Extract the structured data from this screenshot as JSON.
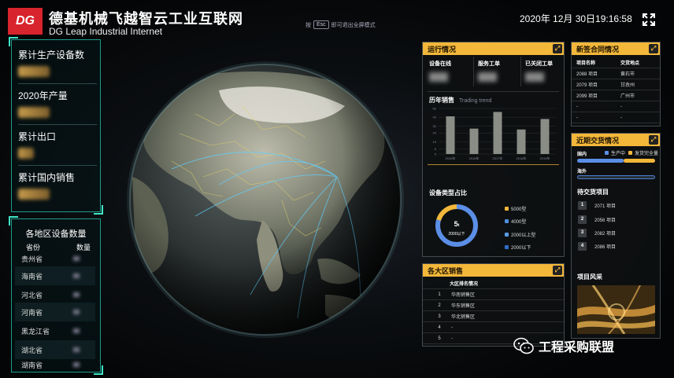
{
  "header": {
    "logo": "DG",
    "title": "德基机械飞越智云工业互联网",
    "subtitle": "DG Leap Industrial Internet",
    "esc_prefix": "按",
    "esc_key": "Esc",
    "esc_suffix": "即可退出全屏模式",
    "datetime": "2020年 12月 30日19:16:58"
  },
  "left_stats": [
    {
      "label": "累计生产设备数"
    },
    {
      "label": "2020年产量"
    },
    {
      "label": "累计出口"
    },
    {
      "label": "累计国内销售"
    }
  ],
  "region": {
    "title": "各地区设备数量",
    "col_province": "省份",
    "col_count": "数量",
    "rows": [
      {
        "province": "贵州省"
      },
      {
        "province": "海南省"
      },
      {
        "province": "河北省"
      },
      {
        "province": "河南省"
      },
      {
        "province": "黑龙江省"
      },
      {
        "province": "湖北省"
      },
      {
        "province": "湖南省"
      }
    ]
  },
  "operation": {
    "title": "运行情况",
    "online": "设备在线",
    "service": "服务工单",
    "closed": "已关闭工单",
    "sales_title": "历年销售",
    "sales_sub": "Trading trend",
    "type_title": "设备类型占比",
    "donut_value": "5",
    "donut_unit": "t",
    "donut_label": "2000以下",
    "legend": [
      {
        "label": "5000型",
        "color": "#f3b73a"
      },
      {
        "label": "4000型",
        "color": "#4e8fe0"
      },
      {
        "label": "2000以上型",
        "color": "#5b9be6"
      },
      {
        "label": "2000以下",
        "color": "#2e6fc8"
      }
    ]
  },
  "chart_data": {
    "type": "bar",
    "categories": [
      "2015年",
      "2016年",
      "2017年",
      "2018年",
      "2019年"
    ],
    "values": [
      43,
      29,
      48,
      28,
      40
    ],
    "ylim": [
      0,
      52
    ],
    "yticks": [
      0,
      6,
      14,
      24,
      32,
      42,
      52
    ],
    "bar_color": "#8a8d86"
  },
  "contracts": {
    "title": "新签合同情况",
    "col_name": "项目名称",
    "col_place": "交货地点",
    "rows": [
      {
        "name": "2088 项目",
        "place": "黄石市"
      },
      {
        "name": "2079 项目",
        "place": "甘孜州"
      },
      {
        "name": "2099 项目",
        "place": "广州市"
      },
      {
        "name": "-",
        "place": "-"
      },
      {
        "name": "-",
        "place": "-"
      }
    ]
  },
  "delivery": {
    "title": "近期交货情况",
    "domestic": "国内",
    "overseas": "海外",
    "leg_prod": "生产中",
    "leg_shipped": "发货完全量",
    "leg_prod_color": "#5b8ee6",
    "leg_shipped_color": "#f3b73a",
    "pending_title": "待交货项目",
    "pending": [
      {
        "no": "1",
        "name": "2071 项目"
      },
      {
        "no": "2",
        "name": "2056 项目"
      },
      {
        "no": "3",
        "name": "2082 项目"
      },
      {
        "no": "4",
        "name": "2086 项目"
      }
    ],
    "photo_title": "项目风采"
  },
  "regions_sales": {
    "title": "各大区销售",
    "col": "大区排名情况",
    "rows": [
      {
        "no": "1",
        "name": "华南销售区"
      },
      {
        "no": "2",
        "name": "华东销售区"
      },
      {
        "no": "3",
        "name": "华北销售区"
      },
      {
        "no": "4",
        "name": "-"
      },
      {
        "no": "5",
        "name": "-"
      }
    ]
  },
  "watermark": "工程采购联盟"
}
